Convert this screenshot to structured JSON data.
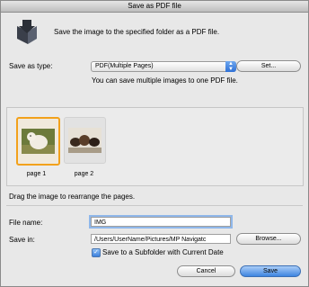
{
  "window": {
    "title": "Save as PDF file"
  },
  "header": {
    "text": "Save the image to the specified folder as a PDF file.",
    "icon": "save-pdf-icon"
  },
  "save_type": {
    "label": "Save as type:",
    "selected": "PDF(Multiple Pages)",
    "set_button": "Set...",
    "note": "You can save multiple images to one PDF file."
  },
  "pages": [
    {
      "caption": "page 1",
      "selected": true,
      "thumb": "dog-photo"
    },
    {
      "caption": "page 2",
      "selected": false,
      "thumb": "puppies-photo"
    }
  ],
  "rearrange_hint": "Drag the image to rearrange the pages.",
  "file": {
    "name_label": "File name:",
    "name_value": "IMG",
    "save_in_label": "Save in:",
    "save_in_value": "/Users/UserName/Pictures/MP Navigatc",
    "browse_button": "Browse...",
    "subfolder_label": "Save to a Subfolder with Current Date",
    "subfolder_checked": true
  },
  "footer": {
    "cancel": "Cancel",
    "save": "Save"
  },
  "colors": {
    "accent": "#3d84e0",
    "selection": "#f2a11b"
  }
}
